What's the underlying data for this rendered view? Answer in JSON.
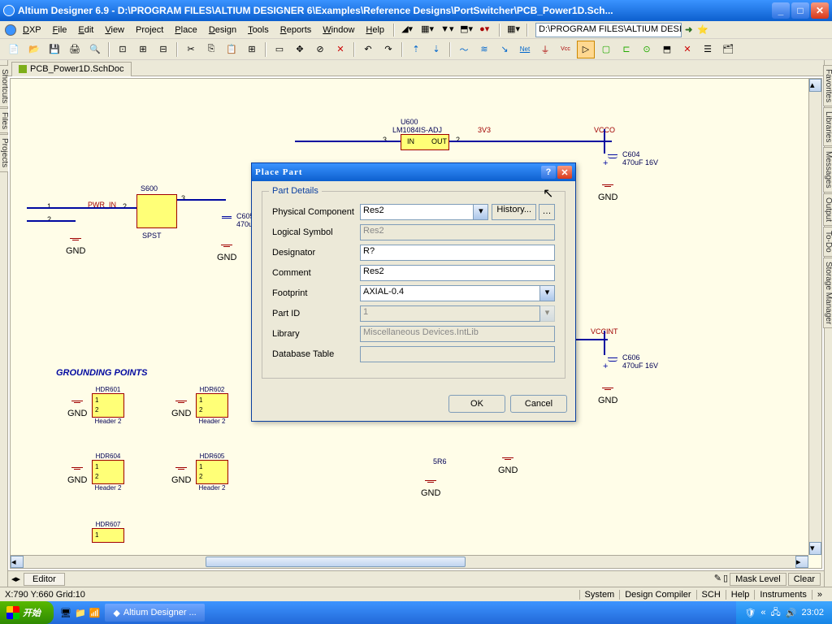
{
  "app": {
    "title": "Altium Designer 6.9 - D:\\PROGRAM FILES\\ALTIUM DESIGNER 6\\Examples\\Reference Designs\\PortSwitcher\\PCB_Power1D.Sch...",
    "pathbox": "D:\\PROGRAM FILES\\ALTIUM DESIGNI"
  },
  "menu": {
    "items": [
      "DXP",
      "File",
      "Edit",
      "View",
      "Project",
      "Place",
      "Design",
      "Tools",
      "Reports",
      "Window",
      "Help"
    ]
  },
  "doctab": {
    "name": "PCB_Power1D.SchDoc"
  },
  "side_left": [
    "Shortcuts",
    "Files",
    "Projects"
  ],
  "side_right": [
    "Favorites",
    "Libraries",
    "Messages",
    "Output",
    "To-Do",
    "Storage Manager"
  ],
  "editor_tab": "Editor",
  "toolbar_right": {
    "mask": "Mask Level",
    "clear": "Clear"
  },
  "status": {
    "coords": "X:790 Y:660  Grid:10",
    "right": [
      "System",
      "Design Compiler",
      "SCH",
      "Help",
      "Instruments"
    ]
  },
  "taskbar": {
    "start": "开始",
    "app": "Altium Designer ...",
    "time": "23:02"
  },
  "dialog": {
    "title": "Place Part",
    "group": "Part Details",
    "labels": {
      "phys": "Physical Component",
      "logical": "Logical Symbol",
      "designator": "Designator",
      "comment": "Comment",
      "footprint": "Footprint",
      "partid": "Part ID",
      "library": "Library",
      "dbtable": "Database Table"
    },
    "values": {
      "phys": "Res2",
      "logical": "Res2",
      "designator": "R?",
      "comment": "Res2",
      "footprint": "AXIAL-0.4",
      "partid": "1",
      "library": "Miscellaneous Devices.IntLib",
      "dbtable": ""
    },
    "history": "History...",
    "ok": "OK",
    "cancel": "Cancel"
  },
  "schematic": {
    "title_ground": "GROUNDING POINTS",
    "u600": {
      "ref": "U600",
      "type": "LM1084IS-ADJ",
      "in": "IN",
      "out": "OUT"
    },
    "nets": {
      "v3": "3V3",
      "vcco": "VCCO",
      "vccint": "VCCINT",
      "pwrin": "PWR_IN",
      "gnd": "GND"
    },
    "s600": {
      "ref": "S600",
      "type": "SPST"
    },
    "c604": {
      "ref": "C604",
      "val": "470uF 16V"
    },
    "c605": {
      "ref": "C605",
      "val": "470u"
    },
    "c606": {
      "ref": "C606",
      "val": "470uF 16V"
    },
    "r5r6": "5R6",
    "hdrs": [
      {
        "ref": "HDR601",
        "type": "Header 2"
      },
      {
        "ref": "HDR602",
        "type": "Header 2"
      },
      {
        "ref": "HDR604",
        "type": "Header 2"
      },
      {
        "ref": "HDR605",
        "type": "Header 2"
      },
      {
        "ref": "HDR607",
        "type": ""
      }
    ]
  }
}
